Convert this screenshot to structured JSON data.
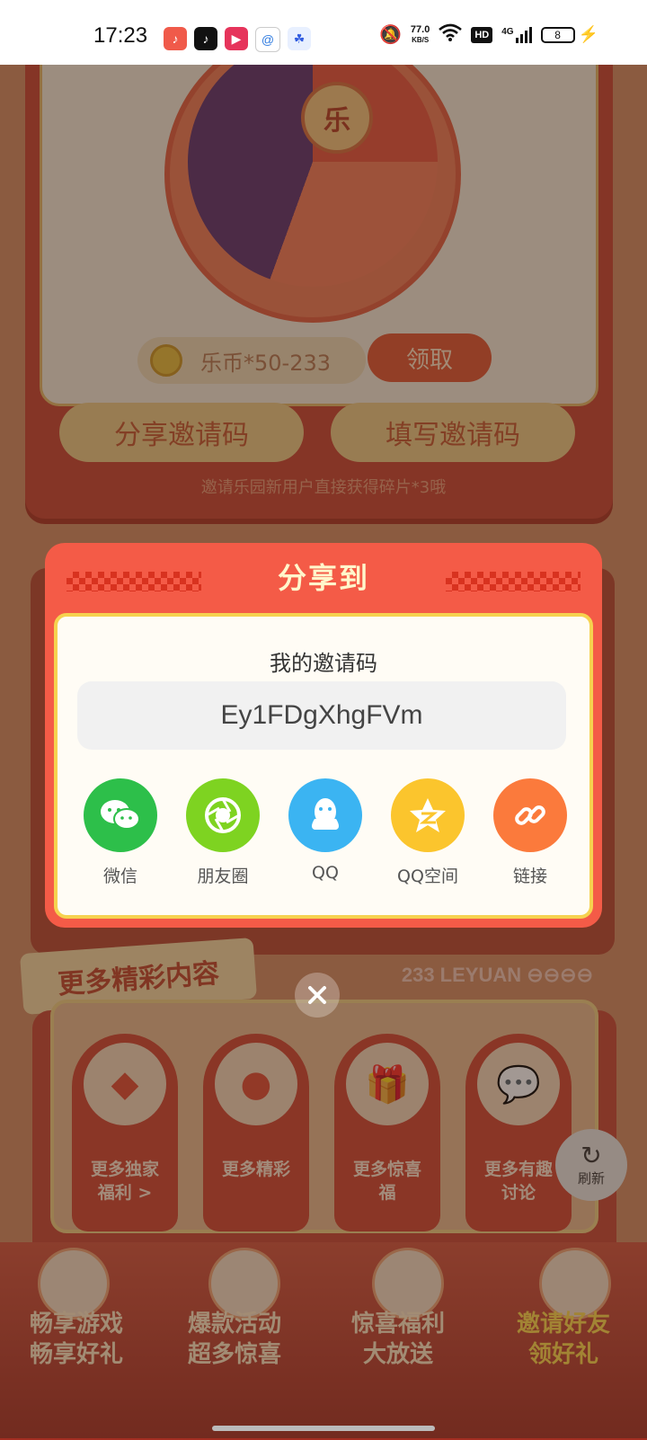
{
  "status_bar": {
    "time": "17:23",
    "net_speed": "77.0",
    "net_speed_unit": "KB/S",
    "hd": "HD",
    "network": "4G",
    "battery": "8"
  },
  "reward": {
    "wheel_center": "乐",
    "coin_text": "乐币*50-233",
    "claim_label": "领取"
  },
  "invite": {
    "share_code_button": "分享邀请码",
    "fill_code_button": "填写邀请码",
    "hint": "邀请乐园新用户直接获得碎片*3哦"
  },
  "more_section": {
    "ribbon": "更多精彩内容",
    "brand": "233 LEYUAN",
    "items": [
      {
        "label_1": "更多独家",
        "label_2": "福利 >"
      },
      {
        "label_1": "更多精彩",
        "label_2": ""
      },
      {
        "label_1": "更多惊喜",
        "label_2": "福"
      },
      {
        "label_1": "更多有趣",
        "label_2": "讨论"
      }
    ],
    "refresh_label": "刷新"
  },
  "bottom_nav": [
    {
      "line_1": "畅享游戏",
      "line_2": "畅享好礼",
      "color": "#ffe9c4"
    },
    {
      "line_1": "爆款活动",
      "line_2": "超多惊喜",
      "color": "#ffe9c4"
    },
    {
      "line_1": "惊喜福利",
      "line_2": "大放送",
      "color": "#ffe9c4"
    },
    {
      "line_1": "邀请好友",
      "line_2": "领好礼",
      "color": "#ffd84a"
    }
  ],
  "share_modal": {
    "title": "分享到",
    "code_label": "我的邀请码",
    "code": "Ey1FDgXhgFVm",
    "options": [
      {
        "name": "微信",
        "icon": "wechat-icon",
        "color": "#2dbf4a"
      },
      {
        "name": "朋友圈",
        "icon": "moments-icon",
        "color": "#7ed321"
      },
      {
        "name": "QQ",
        "icon": "qq-icon",
        "color": "#3bb4f2"
      },
      {
        "name": "QQ空间",
        "icon": "qzone-icon",
        "color": "#fbc52d"
      },
      {
        "name": "链接",
        "icon": "link-icon",
        "color": "#fb7a3c"
      }
    ]
  }
}
